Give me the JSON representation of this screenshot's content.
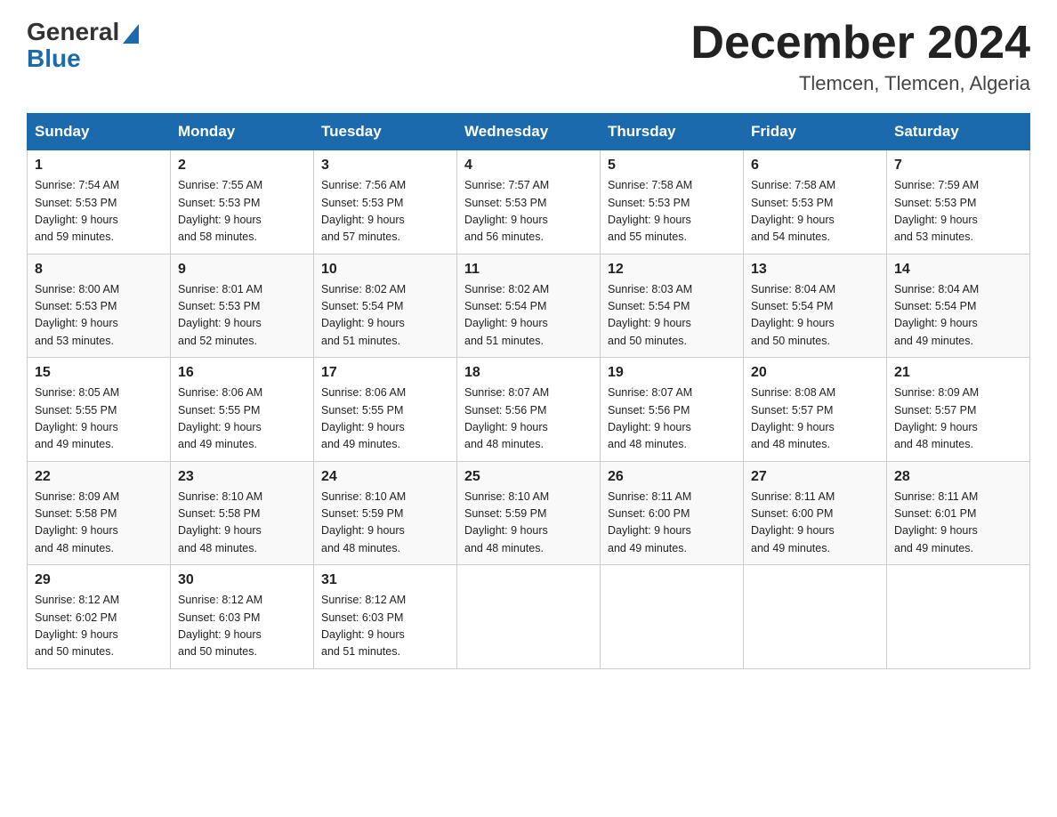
{
  "header": {
    "logo_general": "General",
    "logo_blue": "Blue",
    "month_title": "December 2024",
    "location": "Tlemcen, Tlemcen, Algeria"
  },
  "days_of_week": [
    "Sunday",
    "Monday",
    "Tuesday",
    "Wednesday",
    "Thursday",
    "Friday",
    "Saturday"
  ],
  "weeks": [
    [
      {
        "day": "1",
        "sunrise": "7:54 AM",
        "sunset": "5:53 PM",
        "daylight": "9 hours and 59 minutes."
      },
      {
        "day": "2",
        "sunrise": "7:55 AM",
        "sunset": "5:53 PM",
        "daylight": "9 hours and 58 minutes."
      },
      {
        "day": "3",
        "sunrise": "7:56 AM",
        "sunset": "5:53 PM",
        "daylight": "9 hours and 57 minutes."
      },
      {
        "day": "4",
        "sunrise": "7:57 AM",
        "sunset": "5:53 PM",
        "daylight": "9 hours and 56 minutes."
      },
      {
        "day": "5",
        "sunrise": "7:58 AM",
        "sunset": "5:53 PM",
        "daylight": "9 hours and 55 minutes."
      },
      {
        "day": "6",
        "sunrise": "7:58 AM",
        "sunset": "5:53 PM",
        "daylight": "9 hours and 54 minutes."
      },
      {
        "day": "7",
        "sunrise": "7:59 AM",
        "sunset": "5:53 PM",
        "daylight": "9 hours and 53 minutes."
      }
    ],
    [
      {
        "day": "8",
        "sunrise": "8:00 AM",
        "sunset": "5:53 PM",
        "daylight": "9 hours and 53 minutes."
      },
      {
        "day": "9",
        "sunrise": "8:01 AM",
        "sunset": "5:53 PM",
        "daylight": "9 hours and 52 minutes."
      },
      {
        "day": "10",
        "sunrise": "8:02 AM",
        "sunset": "5:54 PM",
        "daylight": "9 hours and 51 minutes."
      },
      {
        "day": "11",
        "sunrise": "8:02 AM",
        "sunset": "5:54 PM",
        "daylight": "9 hours and 51 minutes."
      },
      {
        "day": "12",
        "sunrise": "8:03 AM",
        "sunset": "5:54 PM",
        "daylight": "9 hours and 50 minutes."
      },
      {
        "day": "13",
        "sunrise": "8:04 AM",
        "sunset": "5:54 PM",
        "daylight": "9 hours and 50 minutes."
      },
      {
        "day": "14",
        "sunrise": "8:04 AM",
        "sunset": "5:54 PM",
        "daylight": "9 hours and 49 minutes."
      }
    ],
    [
      {
        "day": "15",
        "sunrise": "8:05 AM",
        "sunset": "5:55 PM",
        "daylight": "9 hours and 49 minutes."
      },
      {
        "day": "16",
        "sunrise": "8:06 AM",
        "sunset": "5:55 PM",
        "daylight": "9 hours and 49 minutes."
      },
      {
        "day": "17",
        "sunrise": "8:06 AM",
        "sunset": "5:55 PM",
        "daylight": "9 hours and 49 minutes."
      },
      {
        "day": "18",
        "sunrise": "8:07 AM",
        "sunset": "5:56 PM",
        "daylight": "9 hours and 48 minutes."
      },
      {
        "day": "19",
        "sunrise": "8:07 AM",
        "sunset": "5:56 PM",
        "daylight": "9 hours and 48 minutes."
      },
      {
        "day": "20",
        "sunrise": "8:08 AM",
        "sunset": "5:57 PM",
        "daylight": "9 hours and 48 minutes."
      },
      {
        "day": "21",
        "sunrise": "8:09 AM",
        "sunset": "5:57 PM",
        "daylight": "9 hours and 48 minutes."
      }
    ],
    [
      {
        "day": "22",
        "sunrise": "8:09 AM",
        "sunset": "5:58 PM",
        "daylight": "9 hours and 48 minutes."
      },
      {
        "day": "23",
        "sunrise": "8:10 AM",
        "sunset": "5:58 PM",
        "daylight": "9 hours and 48 minutes."
      },
      {
        "day": "24",
        "sunrise": "8:10 AM",
        "sunset": "5:59 PM",
        "daylight": "9 hours and 48 minutes."
      },
      {
        "day": "25",
        "sunrise": "8:10 AM",
        "sunset": "5:59 PM",
        "daylight": "9 hours and 48 minutes."
      },
      {
        "day": "26",
        "sunrise": "8:11 AM",
        "sunset": "6:00 PM",
        "daylight": "9 hours and 49 minutes."
      },
      {
        "day": "27",
        "sunrise": "8:11 AM",
        "sunset": "6:00 PM",
        "daylight": "9 hours and 49 minutes."
      },
      {
        "day": "28",
        "sunrise": "8:11 AM",
        "sunset": "6:01 PM",
        "daylight": "9 hours and 49 minutes."
      }
    ],
    [
      {
        "day": "29",
        "sunrise": "8:12 AM",
        "sunset": "6:02 PM",
        "daylight": "9 hours and 50 minutes."
      },
      {
        "day": "30",
        "sunrise": "8:12 AM",
        "sunset": "6:03 PM",
        "daylight": "9 hours and 50 minutes."
      },
      {
        "day": "31",
        "sunrise": "8:12 AM",
        "sunset": "6:03 PM",
        "daylight": "9 hours and 51 minutes."
      },
      null,
      null,
      null,
      null
    ]
  ],
  "labels": {
    "sunrise_prefix": "Sunrise: ",
    "sunset_prefix": "Sunset: ",
    "daylight_prefix": "Daylight: "
  }
}
